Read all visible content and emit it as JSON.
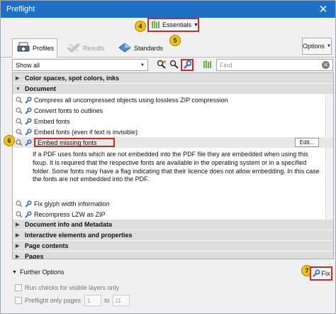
{
  "window": {
    "title": "Preflight"
  },
  "profiles_select": {
    "label": "Essentials"
  },
  "callouts": {
    "c4": "4",
    "c5": "5",
    "c6": "6",
    "c7": "7"
  },
  "tabs": [
    {
      "label": "Profiles"
    },
    {
      "label": "Results"
    },
    {
      "label": "Standards"
    }
  ],
  "options_label": "Options",
  "filter": {
    "value": "Show all"
  },
  "search": {
    "placeholder": "Find"
  },
  "categories": {
    "color": "Color spaces, spot colors, inks",
    "document": "Document",
    "docinfo": "Document info and Metadata",
    "interactive": "Interactive elements and properties",
    "pagecontents": "Page contents",
    "pages": "Pages"
  },
  "fixups": [
    "Compress all uncompressed objects using lossless ZIP compression",
    "Convert fonts to outlines",
    "Embed fonts",
    "Embed fonts (even if text is invisible)",
    "Embed missing fonts",
    "Fix glyph width information",
    "Recompress LZW as ZIP"
  ],
  "edit_label": "Edit...",
  "description": "If a PDF uses fonts which are not embedded into the PDF file they are embedded when using this fixup. It is required that the respective fonts are available in the operating system or in a specified folder. Some fonts may have a flag indicating that their licence does not allow embedding. In this case the fonts are not embedded into the PDF.",
  "further_options": "Further Options",
  "fix_label": "Fix",
  "run_checks_label": "Run checks for visible layers only",
  "preflight_pages_label": "Preflight only pages",
  "page_from": "1",
  "page_to_label": "to",
  "page_to": "11",
  "colors": {
    "accent_red": "#c72b2b",
    "titlebar": "#1f6fc6",
    "callout": "#f2c200"
  }
}
